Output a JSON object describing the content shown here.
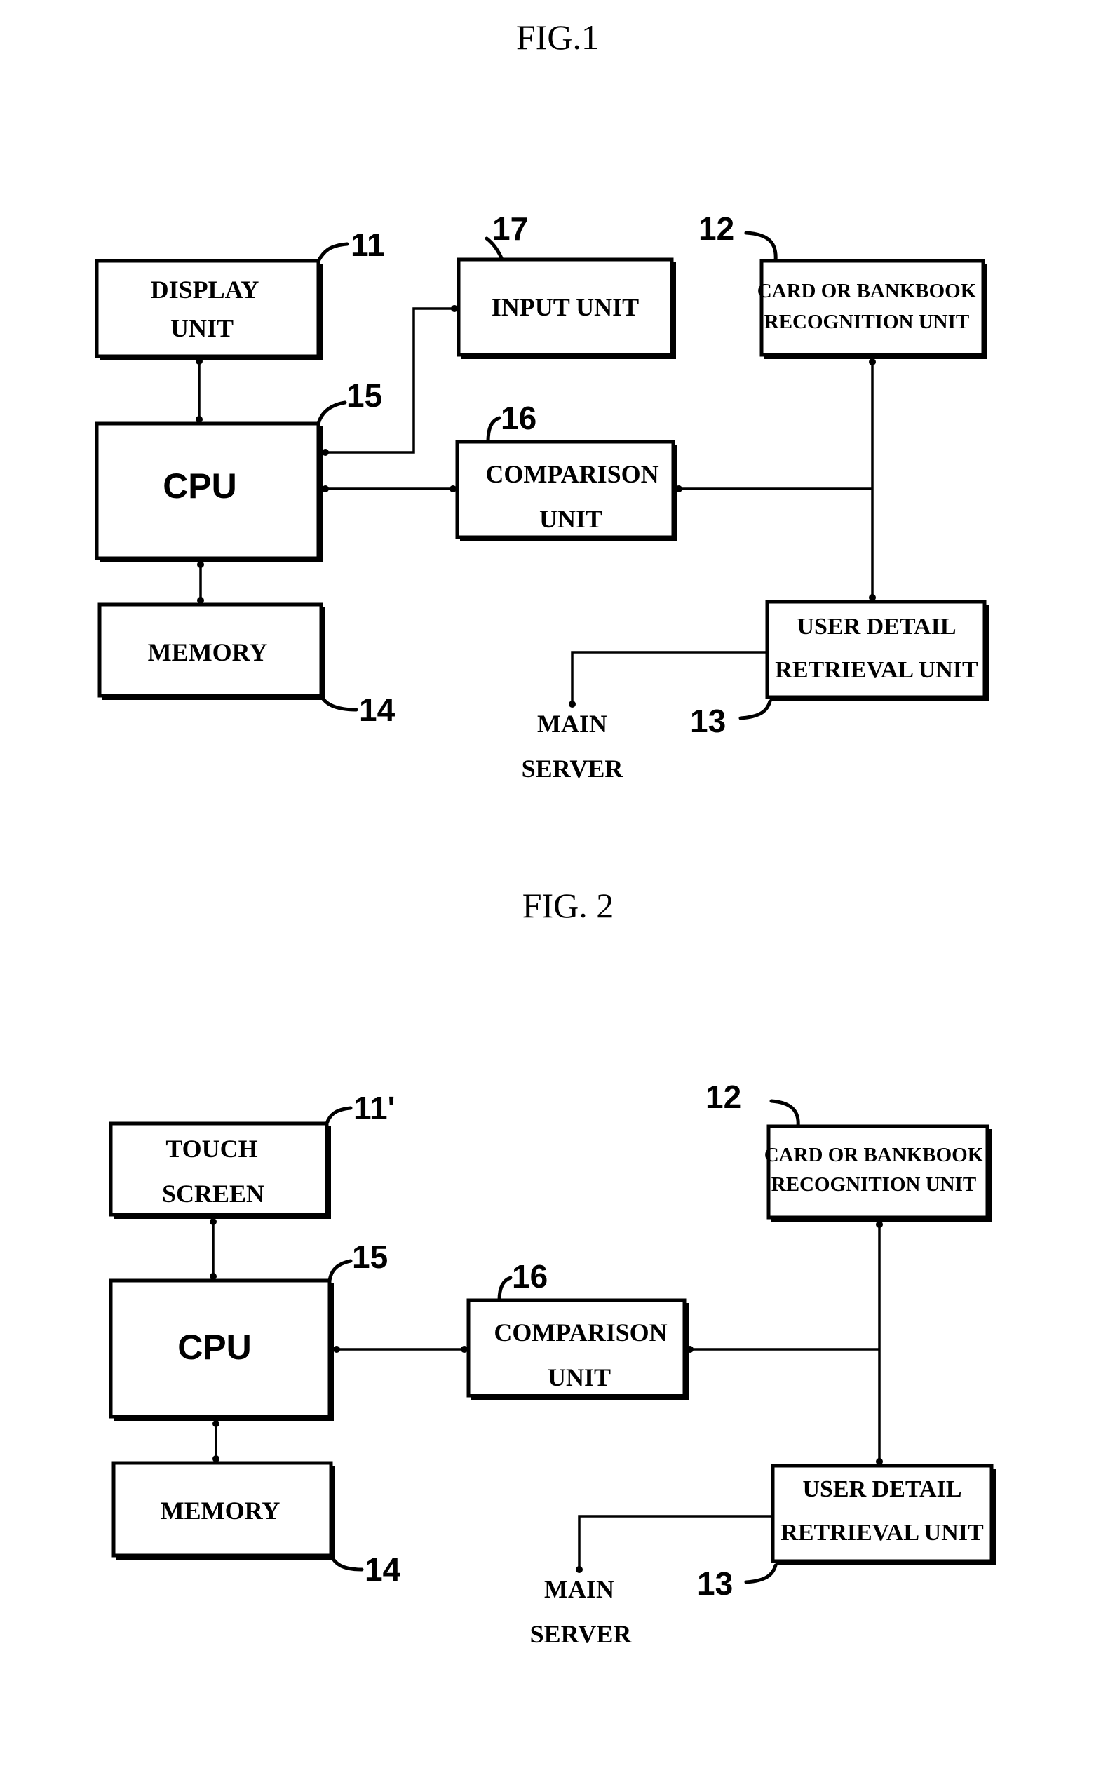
{
  "figures": [
    {
      "title": "FIG.1",
      "blocks": {
        "display": {
          "lines": [
            "DISPLAY",
            "UNIT"
          ],
          "ref": "11"
        },
        "cpu": {
          "lines": [
            "CPU"
          ],
          "ref": "15"
        },
        "memory": {
          "lines": [
            "MEMORY"
          ],
          "ref": "14"
        },
        "input": {
          "lines": [
            "INPUT UNIT"
          ],
          "ref": "17"
        },
        "comparison": {
          "lines": [
            "COMPARISON",
            "UNIT"
          ],
          "ref": "16"
        },
        "recognition": {
          "lines": [
            "CARD OR BANKBOOK",
            "RECOGNITION UNIT"
          ],
          "ref": "12"
        },
        "retrieval": {
          "lines": [
            "USER DETAIL",
            "RETRIEVAL UNIT"
          ],
          "ref": "13"
        },
        "server": {
          "lines": [
            "MAIN",
            "SERVER"
          ]
        }
      }
    },
    {
      "title": "FIG. 2",
      "blocks": {
        "display": {
          "lines": [
            "TOUCH",
            "SCREEN"
          ],
          "ref": "11'"
        },
        "cpu": {
          "lines": [
            "CPU"
          ],
          "ref": "15"
        },
        "memory": {
          "lines": [
            "MEMORY"
          ],
          "ref": "14"
        },
        "comparison": {
          "lines": [
            "COMPARISON",
            "UNIT"
          ],
          "ref": "16"
        },
        "recognition": {
          "lines": [
            "CARD OR BANKBOOK",
            "RECOGNITION UNIT"
          ],
          "ref": "12"
        },
        "retrieval": {
          "lines": [
            "USER DETAIL",
            "RETRIEVAL UNIT"
          ],
          "ref": "13"
        },
        "server": {
          "lines": [
            "MAIN",
            "SERVER"
          ]
        }
      }
    }
  ]
}
